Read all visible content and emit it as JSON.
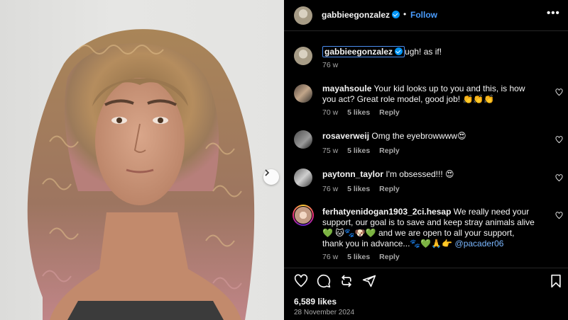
{
  "post": {
    "username": "gabbieegonzalez",
    "separator": "•",
    "follow_label": "Follow",
    "more_label": "•••",
    "likes": "6,589 likes",
    "date": "28 November 2024"
  },
  "caption": {
    "username": "gabbieegonzalez",
    "text": "ugh! as if!",
    "time": "76 w"
  },
  "comments": [
    {
      "username": "mayahsoule",
      "text": " Your kid looks up to you and this, is how you act? Great role model, good job! 👏👏👏",
      "time": "70 w",
      "likes": "5 likes",
      "reply": "Reply"
    },
    {
      "username": "rosaverweij",
      "text": " Omg the eyebrowwww😍",
      "time": "75 w",
      "likes": "5 likes",
      "reply": "Reply"
    },
    {
      "username": "paytonn_taylor",
      "text": " I'm obsessed!!! 😍",
      "time": "76 w",
      "likes": "5 likes",
      "reply": "Reply"
    },
    {
      "username": "ferhatyenidogan1903_2ci.hesap",
      "text": " We really need your support, our goal is to save and keep stray animals alive💚 🐱🐾🐶💚 and we are open to all your support, thank you in advance...🐾💚🙏👉 ",
      "mention": "@pacader06",
      "time": "76 w",
      "likes": "5 likes",
      "reply": "Reply"
    }
  ],
  "icons": {
    "like": "heart-icon",
    "comment": "comment-icon",
    "share": "repost-icon",
    "send": "send-icon",
    "save": "bookmark-icon",
    "carousel_next": "chevron-right-icon"
  },
  "colors": {
    "accent": "#4a9dff",
    "background": "#000000",
    "muted": "#a8a8a8"
  }
}
